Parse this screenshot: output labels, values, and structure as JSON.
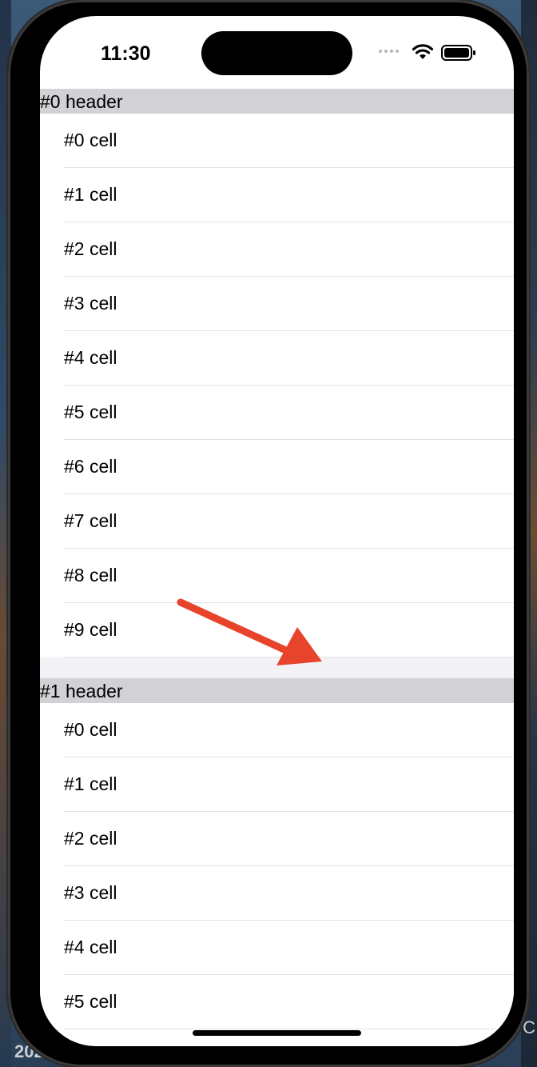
{
  "status_bar": {
    "time": "11:30"
  },
  "sections": [
    {
      "header": "#0 header",
      "cells": [
        "#0 cell",
        "#1 cell",
        "#2 cell",
        "#3 cell",
        "#4 cell",
        "#5 cell",
        "#6 cell",
        "#7 cell",
        "#8 cell",
        "#9 cell"
      ]
    },
    {
      "header": "#1 header",
      "cells": [
        "#0 cell",
        "#1 cell",
        "#2 cell",
        "#3 cell",
        "#4 cell",
        "#5 cell"
      ]
    }
  ],
  "background": {
    "left_text": "202",
    "right_text": "n C"
  },
  "colors": {
    "section_header_bg": "#d1d1d6",
    "section_gap_bg": "#f2f2f7",
    "annotation_arrow": "#e8442c"
  }
}
